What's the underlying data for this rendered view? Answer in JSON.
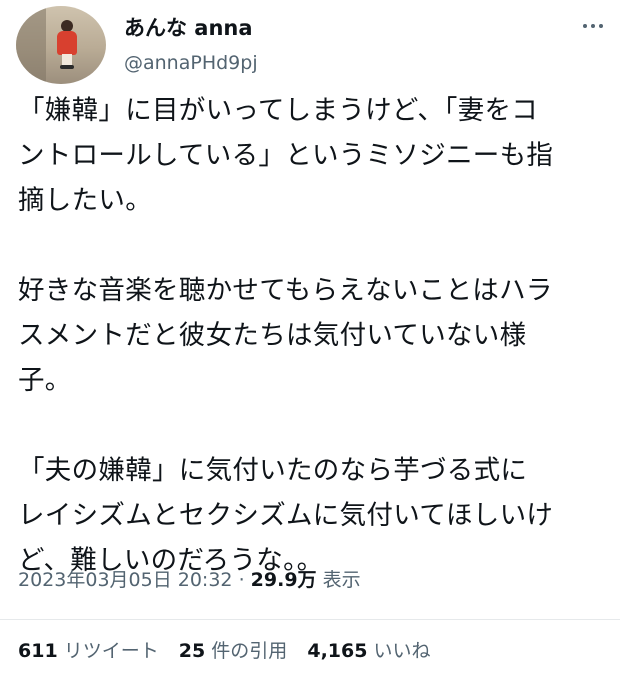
{
  "author": {
    "display_name": "あんな anna",
    "handle": "@annaPHd9pj",
    "avatar_icon": "profile-photo-child-in-red-coat"
  },
  "more_icon": "more-dots-icon",
  "tweet": {
    "lines_p1": [
      "「嫌韓」に目がいってしまうけど、「妻をコ",
      "ントロールしている」というミソジニーも指",
      "摘したい。"
    ],
    "lines_p2": [
      "好きな音楽を聴かせてもらえないことはハラ",
      "スメントだと彼女たちは気付いていない様",
      "子。"
    ],
    "lines_p3": [
      "「夫の嫌韓」に気付いたのなら芋づる式に",
      "レイシズムとセクシズムに気付いてほしいけ",
      "ど、難しいのだろうな。。"
    ]
  },
  "meta": {
    "timestamp": "2023年03月05日 20:32",
    "separator": "·",
    "views_count": "29.9万",
    "views_label": "表示"
  },
  "stats": {
    "retweets_count": "611",
    "retweets_label": "リツイート",
    "quotes_count": "25",
    "quotes_label": "件の引用",
    "likes_count": "4,165",
    "likes_label": "いいね"
  },
  "colors": {
    "text_primary": "#0f1419",
    "text_secondary": "#536471",
    "divider": "#e6e9eb"
  }
}
